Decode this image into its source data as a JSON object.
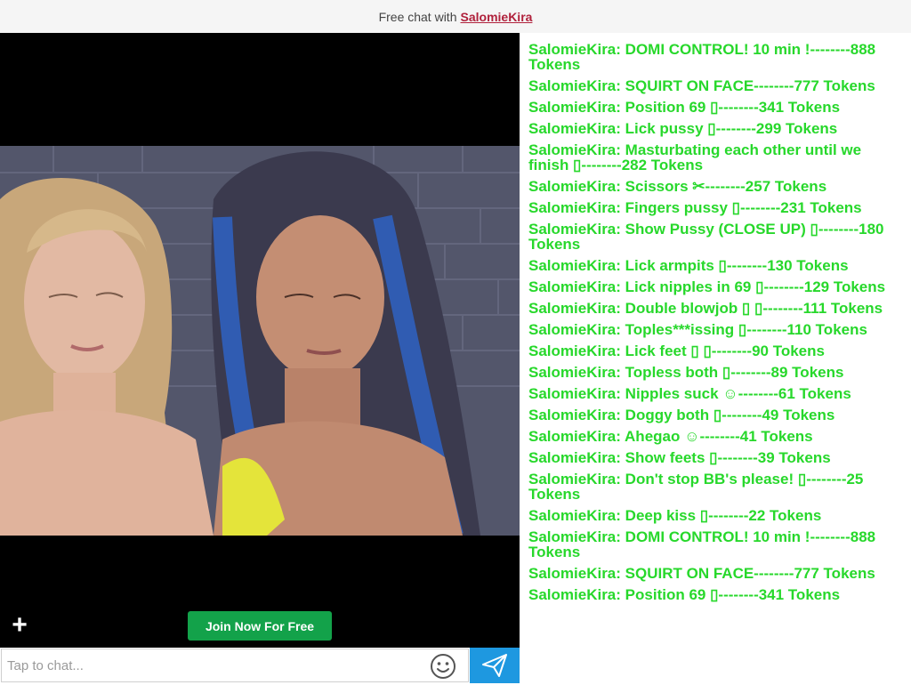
{
  "header": {
    "prefix": "Free chat with",
    "model_name": "SalomieKira"
  },
  "video": {
    "join_button": "Join Now For Free",
    "plus_label": "+"
  },
  "chat_input": {
    "placeholder": "Tap to chat..."
  },
  "icons": {
    "emoji": "smiley-face-icon",
    "send": "paper-plane-send-icon",
    "add": "plus-icon"
  },
  "colors": {
    "chat_text": "#27d82b",
    "join_button": "#13a24a",
    "send_button": "#1e98e0",
    "model_link": "#b0213c"
  },
  "messages": [
    {
      "user": "SalomieKira:",
      "text": "DOMI CONTROL! 10 min !--------888 Tokens"
    },
    {
      "user": "SalomieKira:",
      "text": "SQUIRT ON FACE--------777 Tokens"
    },
    {
      "user": "SalomieKira:",
      "text": "Position 69 ▯--------341 Tokens"
    },
    {
      "user": "SalomieKira:",
      "text": "Lick pussy ▯--------299 Tokens"
    },
    {
      "user": "SalomieKira:",
      "text": "Masturbating each other until we finish ▯--------282 Tokens"
    },
    {
      "user": "SalomieKira:",
      "text": "Scissors ✂--------257 Tokens"
    },
    {
      "user": "SalomieKira:",
      "text": "Fingers pussy ▯--------231 Tokens"
    },
    {
      "user": "SalomieKira:",
      "text": "Show Pussy (CLOSE UP) ▯--------180 Tokens"
    },
    {
      "user": "SalomieKira:",
      "text": "Lick armpits ▯--------130 Tokens"
    },
    {
      "user": "SalomieKira:",
      "text": "Lick nipples in 69 ▯--------129 Tokens"
    },
    {
      "user": "SalomieKira:",
      "text": "Double blowjob ▯ ▯--------111 Tokens"
    },
    {
      "user": "SalomieKira:",
      "text": "Toples***issing ▯--------110 Tokens"
    },
    {
      "user": "SalomieKira:",
      "text": "Lick feet ▯ ▯--------90 Tokens"
    },
    {
      "user": "SalomieKira:",
      "text": "Topless both ▯--------89 Tokens"
    },
    {
      "user": "SalomieKira:",
      "text": "Nipples suck ☺--------61 Tokens"
    },
    {
      "user": "SalomieKira:",
      "text": "Doggy both ▯--------49 Tokens"
    },
    {
      "user": "SalomieKira:",
      "text": "Ahegao ☺--------41 Tokens"
    },
    {
      "user": "SalomieKira:",
      "text": "Show feets ▯--------39 Tokens"
    },
    {
      "user": "SalomieKira:",
      "text": "Don't stop BB's please! ▯--------25 Tokens"
    },
    {
      "user": "SalomieKira:",
      "text": "Deep kiss ▯--------22 Tokens"
    },
    {
      "user": "SalomieKira:",
      "text": "DOMI CONTROL! 10 min !--------888 Tokens"
    },
    {
      "user": "SalomieKira:",
      "text": "SQUIRT ON FACE--------777 Tokens"
    },
    {
      "user": "SalomieKira:",
      "text": "Position 69 ▯--------341 Tokens"
    }
  ]
}
